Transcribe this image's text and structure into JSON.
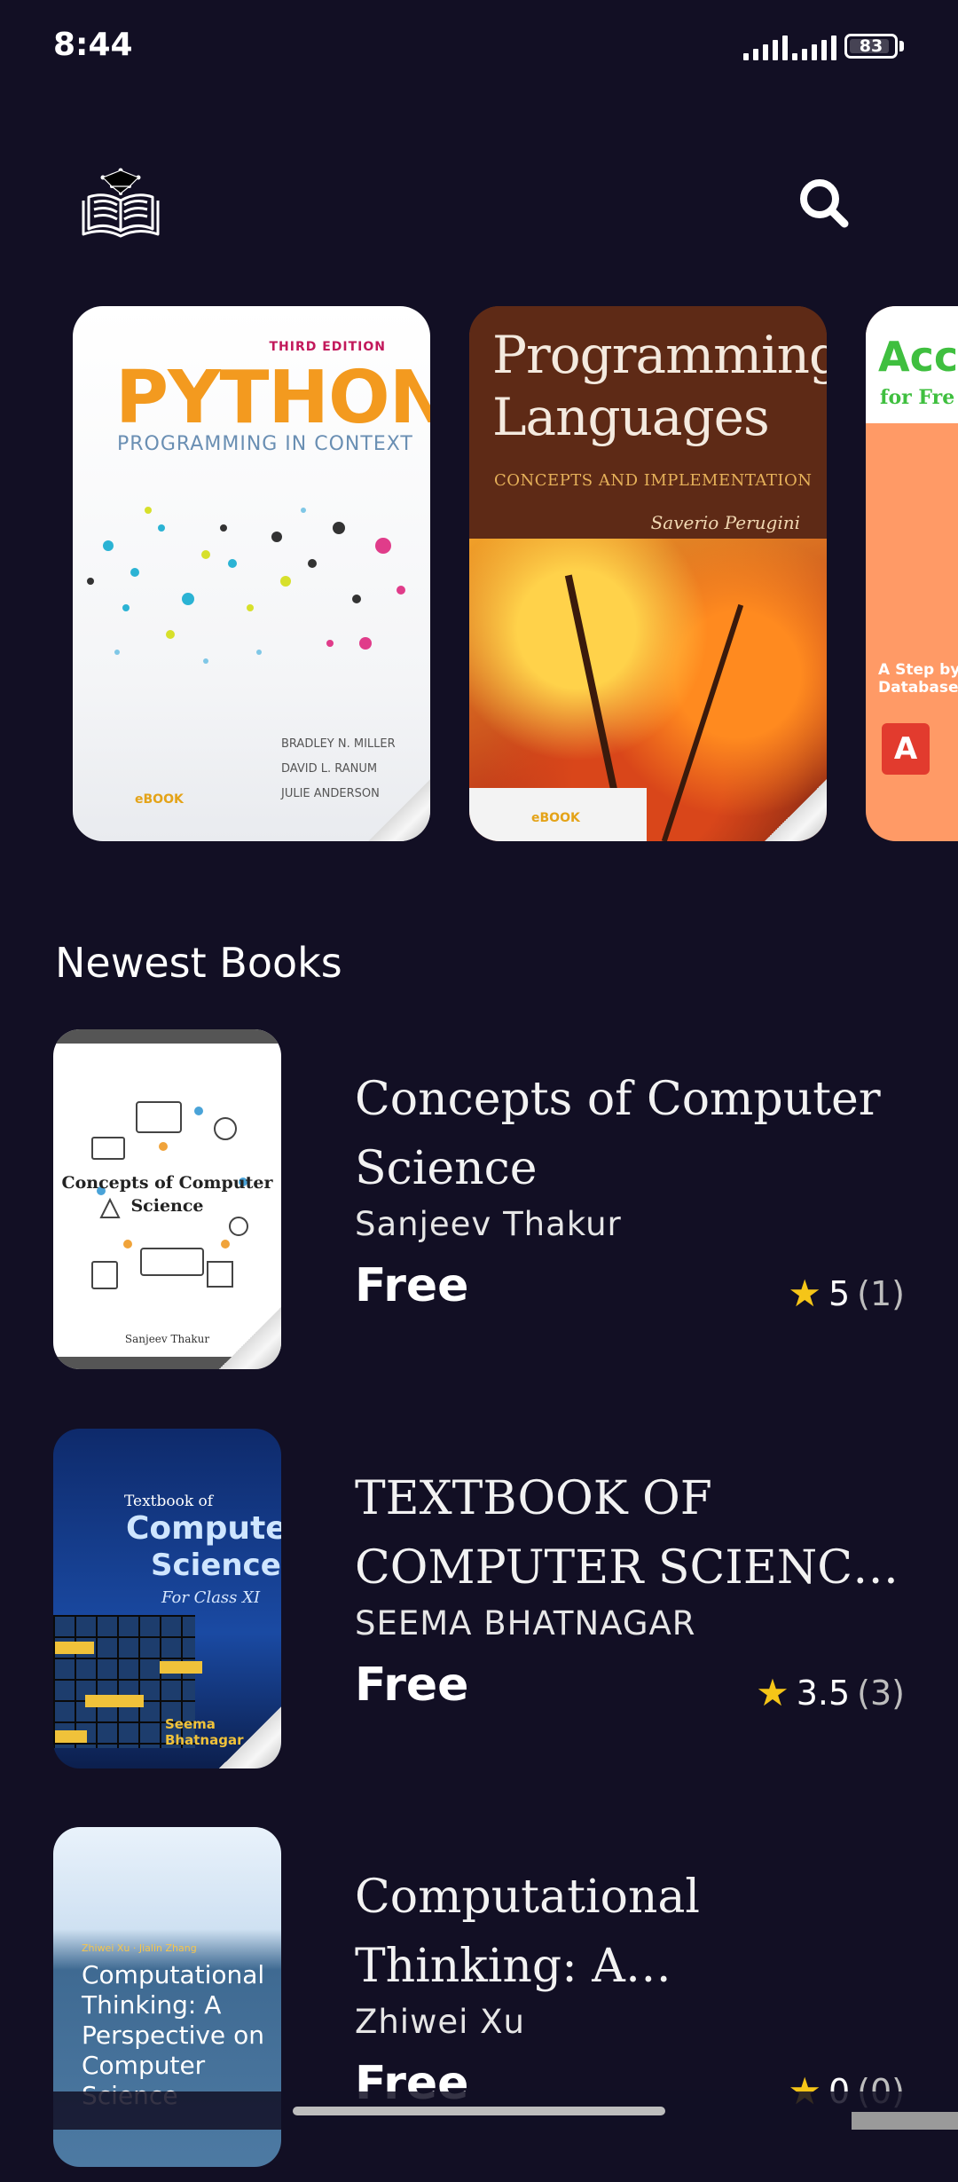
{
  "status_bar": {
    "time": "8:44",
    "battery": "83"
  },
  "header": {
    "logo_icon": "open-book-logo-icon",
    "search_icon": "search-icon"
  },
  "carousel": [
    {
      "edition": "THIRD EDITION",
      "title": "PYTHON",
      "subtitle": "PROGRAMMING IN CONTEXT",
      "authors": [
        "BRADLEY N. MILLER",
        "DAVID L. RANUM",
        "JULIE ANDERSON"
      ],
      "badge": "eBOOK"
    },
    {
      "title_line1": "Programming",
      "title_line2": "Languages",
      "subtitle": "CONCEPTS AND IMPLEMENTATION",
      "author": "Saverio Perugini",
      "badge": "eBOOK"
    },
    {
      "title": "Acc",
      "subtitle": "for Fre",
      "note": "A Step by",
      "note2": "Database-",
      "logo": "A"
    }
  ],
  "section_title": "Newest Books",
  "books": [
    {
      "title": "Concepts of Computer Science",
      "author": "Sanjeev Thakur",
      "price": "Free",
      "rating": "5",
      "rating_count": "(1)",
      "cover_title": "Concepts of Computer Science",
      "cover_author": "Sanjeev Thakur"
    },
    {
      "title": "TEXTBOOK OF COMPUTER SCIENCE ...",
      "author": "SEEMA BHATNAGAR",
      "price": "Free",
      "rating": "3.5",
      "rating_count": "(3)",
      "cover_small": "Textbook of",
      "cover_big1": "Computer",
      "cover_big2": "Science",
      "cover_class": "For Class XI",
      "cover_author": "Seema Bhatnagar"
    },
    {
      "title": "Computational Thinking: A Perspective on Comp...",
      "author": "Zhiwei Xu",
      "price": "Free",
      "rating": "0",
      "rating_count": "(0)",
      "cover_authors": "Zhiwei Xu · Jialin Zhang",
      "cover_title": "Computational Thinking: A Perspective on Computer Science"
    }
  ],
  "colors": {
    "background": "#120f24",
    "star": "#f5c518",
    "text": "#ffffff",
    "muted": "#bdbdbd"
  }
}
